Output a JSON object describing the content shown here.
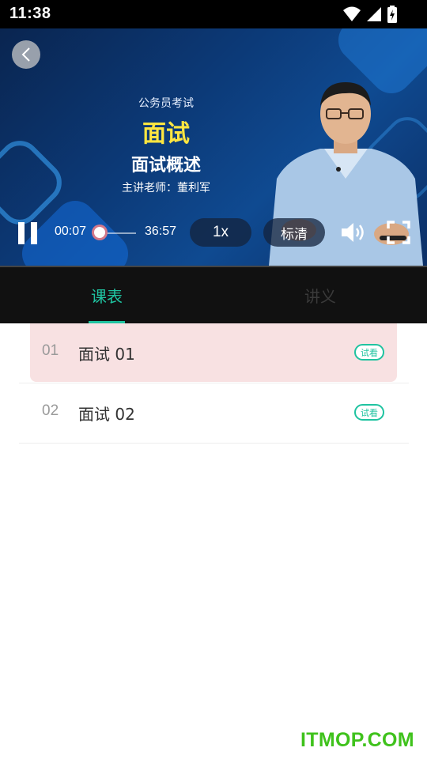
{
  "status_bar": {
    "time": "11:38"
  },
  "player": {
    "slide": {
      "subtitle": "公务员考试",
      "title": "面试",
      "topic": "面试概述",
      "teacher": "主讲老师：董利军"
    },
    "controls": {
      "current_time": "00:07",
      "total_time": "36:57",
      "progress": 0.003,
      "speed_label": "1x",
      "quality_label": "标清"
    }
  },
  "tabs": [
    {
      "label": "课表",
      "active": true
    },
    {
      "label": "讲义",
      "active": false
    }
  ],
  "lessons": [
    {
      "number": "01",
      "title": "面试 01",
      "badge": "试看",
      "active": true
    },
    {
      "number": "02",
      "title": "面试 02",
      "badge": "试看",
      "active": false
    }
  ],
  "watermark": "ITMOP.COM",
  "colors": {
    "accent": "#1fc3a0",
    "highlight": "#f8e1e2",
    "slide_title": "#ffe640"
  }
}
